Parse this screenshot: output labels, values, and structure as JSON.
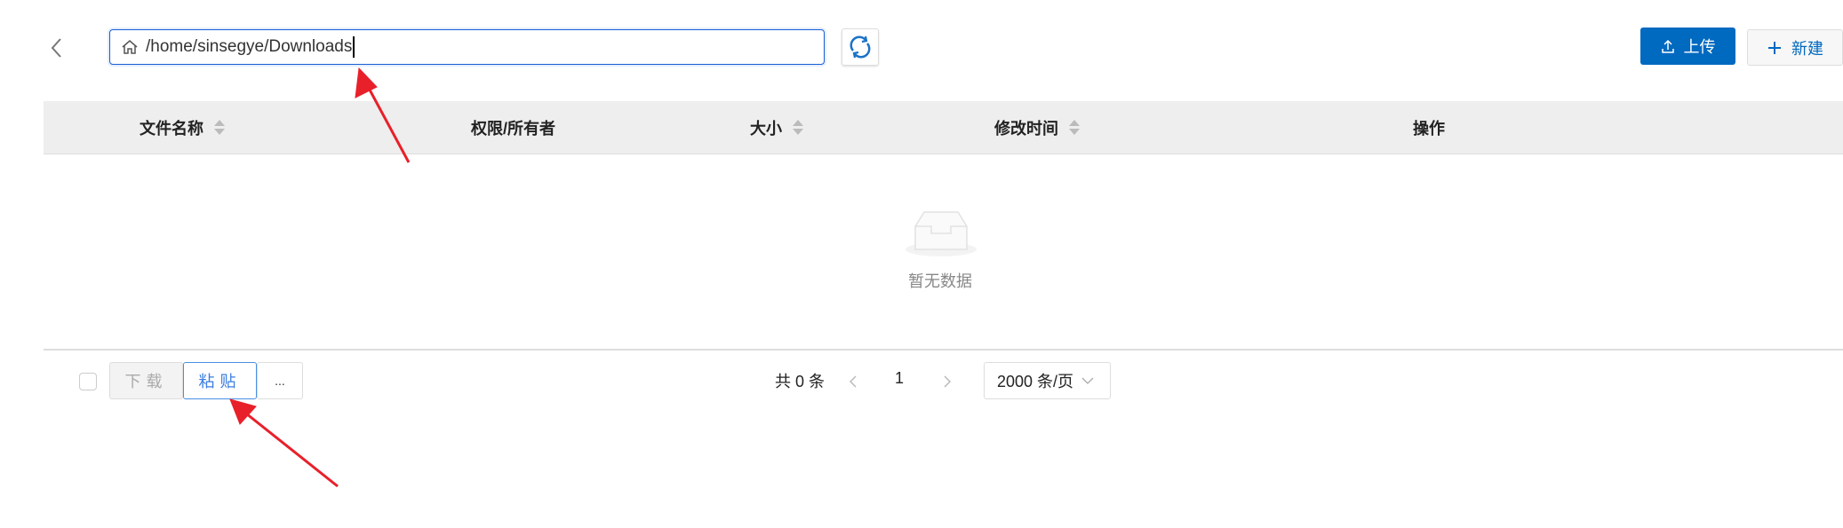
{
  "toolbar": {
    "path_value": "/home/sinsegye/Downloads",
    "upload_label": "上传",
    "new_label": "新建"
  },
  "table": {
    "columns": [
      {
        "label": "文件名称",
        "sortable": true
      },
      {
        "label": "权限/所有者",
        "sortable": false
      },
      {
        "label": "大小",
        "sortable": true
      },
      {
        "label": "修改时间",
        "sortable": true
      },
      {
        "label": "操作",
        "sortable": false
      }
    ],
    "empty_text": "暂无数据"
  },
  "footer": {
    "download_label": "下载",
    "paste_label": "粘贴",
    "more_label": "...",
    "total_text": "共 0 条",
    "current_page": "1",
    "page_size": "2000 条/页"
  },
  "colors": {
    "accent": "#0069c0",
    "annotation": "#e8202a"
  }
}
